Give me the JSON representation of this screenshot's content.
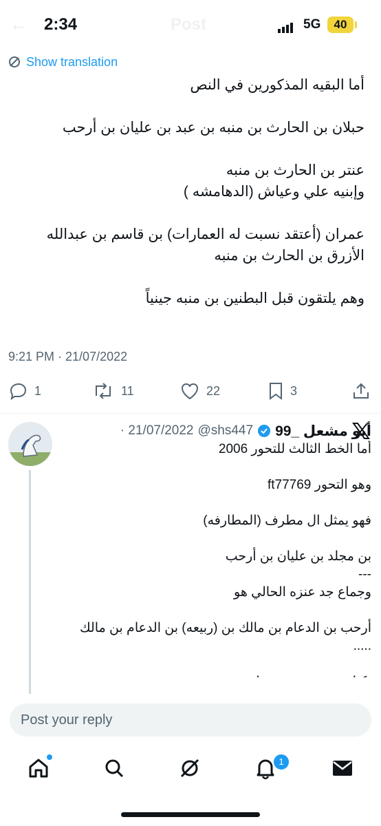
{
  "status_bar": {
    "time": "2:34",
    "network": "5G",
    "battery": "40",
    "battery_color": "#f2d43c"
  },
  "header": {
    "title": "Post",
    "back_icon": "arrow-left-icon"
  },
  "tweet": {
    "show_translation_label": "Show translation",
    "text": "أما البقيه المذكورين في النص\n\nحبلان بن الحارث بن منبه بن عبد بن عليان بن أرحب\n\nعنتر بن الحارث بن منبه\nوإبنيه علي وعياش (الدهامشه )\n\nعمران (أعتقد نسبت له العمارات) بن قاسم بن عبدالله الأزرق بن الحارث بن منبه\n\nوهم يلتقون قبل البطنين بن منبه جينياً",
    "timestamp": "9:21 PM · 21/07/2022",
    "stats": {
      "replies": "1",
      "reposts": "11",
      "likes": "22",
      "bookmarks": "3"
    }
  },
  "reply": {
    "author_name": "أبو مشعل _99",
    "handle": "@shs447",
    "date": "· 21/07/2022",
    "verified_color": "#1d9bf0",
    "text": "أما الخط الثالث للتحور 2006\n\nوهو التحور ft77769\n\nفهو يمثل ال مطرف (المطارفه)\n\nبن مجلد بن عليان بن أرحب\n---\nوجماع جد عنزه الحالي هو\n\nأرحب بن الدعام بن مالك بن (ربيعه) بن الدعام بن مالك .....\n\nبكيل بن نوف بن همدان"
  },
  "composer": {
    "placeholder": "Post your reply"
  },
  "tabbar": {
    "notifications_badge": "1",
    "accent": "#1d9bf0"
  }
}
